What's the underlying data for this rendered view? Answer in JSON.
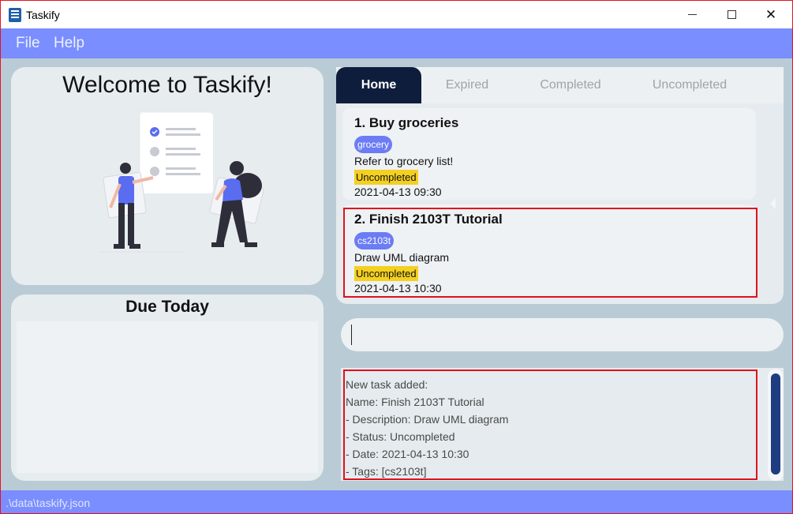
{
  "window": {
    "title": "Taskify"
  },
  "menu": {
    "items": [
      {
        "label": "File"
      },
      {
        "label": "Help"
      }
    ]
  },
  "welcome": {
    "title": "Welcome to Taskify!"
  },
  "due_today": {
    "title": "Due Today",
    "items": []
  },
  "tabs": [
    {
      "label": "Home",
      "selected": true
    },
    {
      "label": "Expired",
      "selected": false
    },
    {
      "label": "Completed",
      "selected": false
    },
    {
      "label": "Uncompleted",
      "selected": false
    }
  ],
  "tasks": [
    {
      "name": "1. Buy groceries",
      "tag": "grocery",
      "description": "Refer to grocery list!",
      "status": "Uncompleted",
      "date": "2021-04-13 09:30"
    },
    {
      "name": "2. Finish 2103T Tutorial",
      "tag": "cs2103t",
      "description": "Draw UML diagram",
      "status": "Uncompleted",
      "date": "2021-04-13 10:30"
    }
  ],
  "command": {
    "value": ""
  },
  "result": {
    "lines": [
      "New task added:",
      "Name: Finish 2103T Tutorial",
      "- Description: Draw UML diagram",
      "- Status: Uncompleted",
      "- Date: 2021-04-13 10:30",
      "- Tags: [cs2103t]"
    ]
  },
  "status_bar": {
    "path": ".\\data\\taskify.json"
  },
  "colors": {
    "accent": "#7a8eff",
    "tab_selected": "#0f1d3d",
    "tag": "#6b7cf5",
    "status_uncompleted": "#f4d020",
    "highlight": "#e0101c"
  }
}
